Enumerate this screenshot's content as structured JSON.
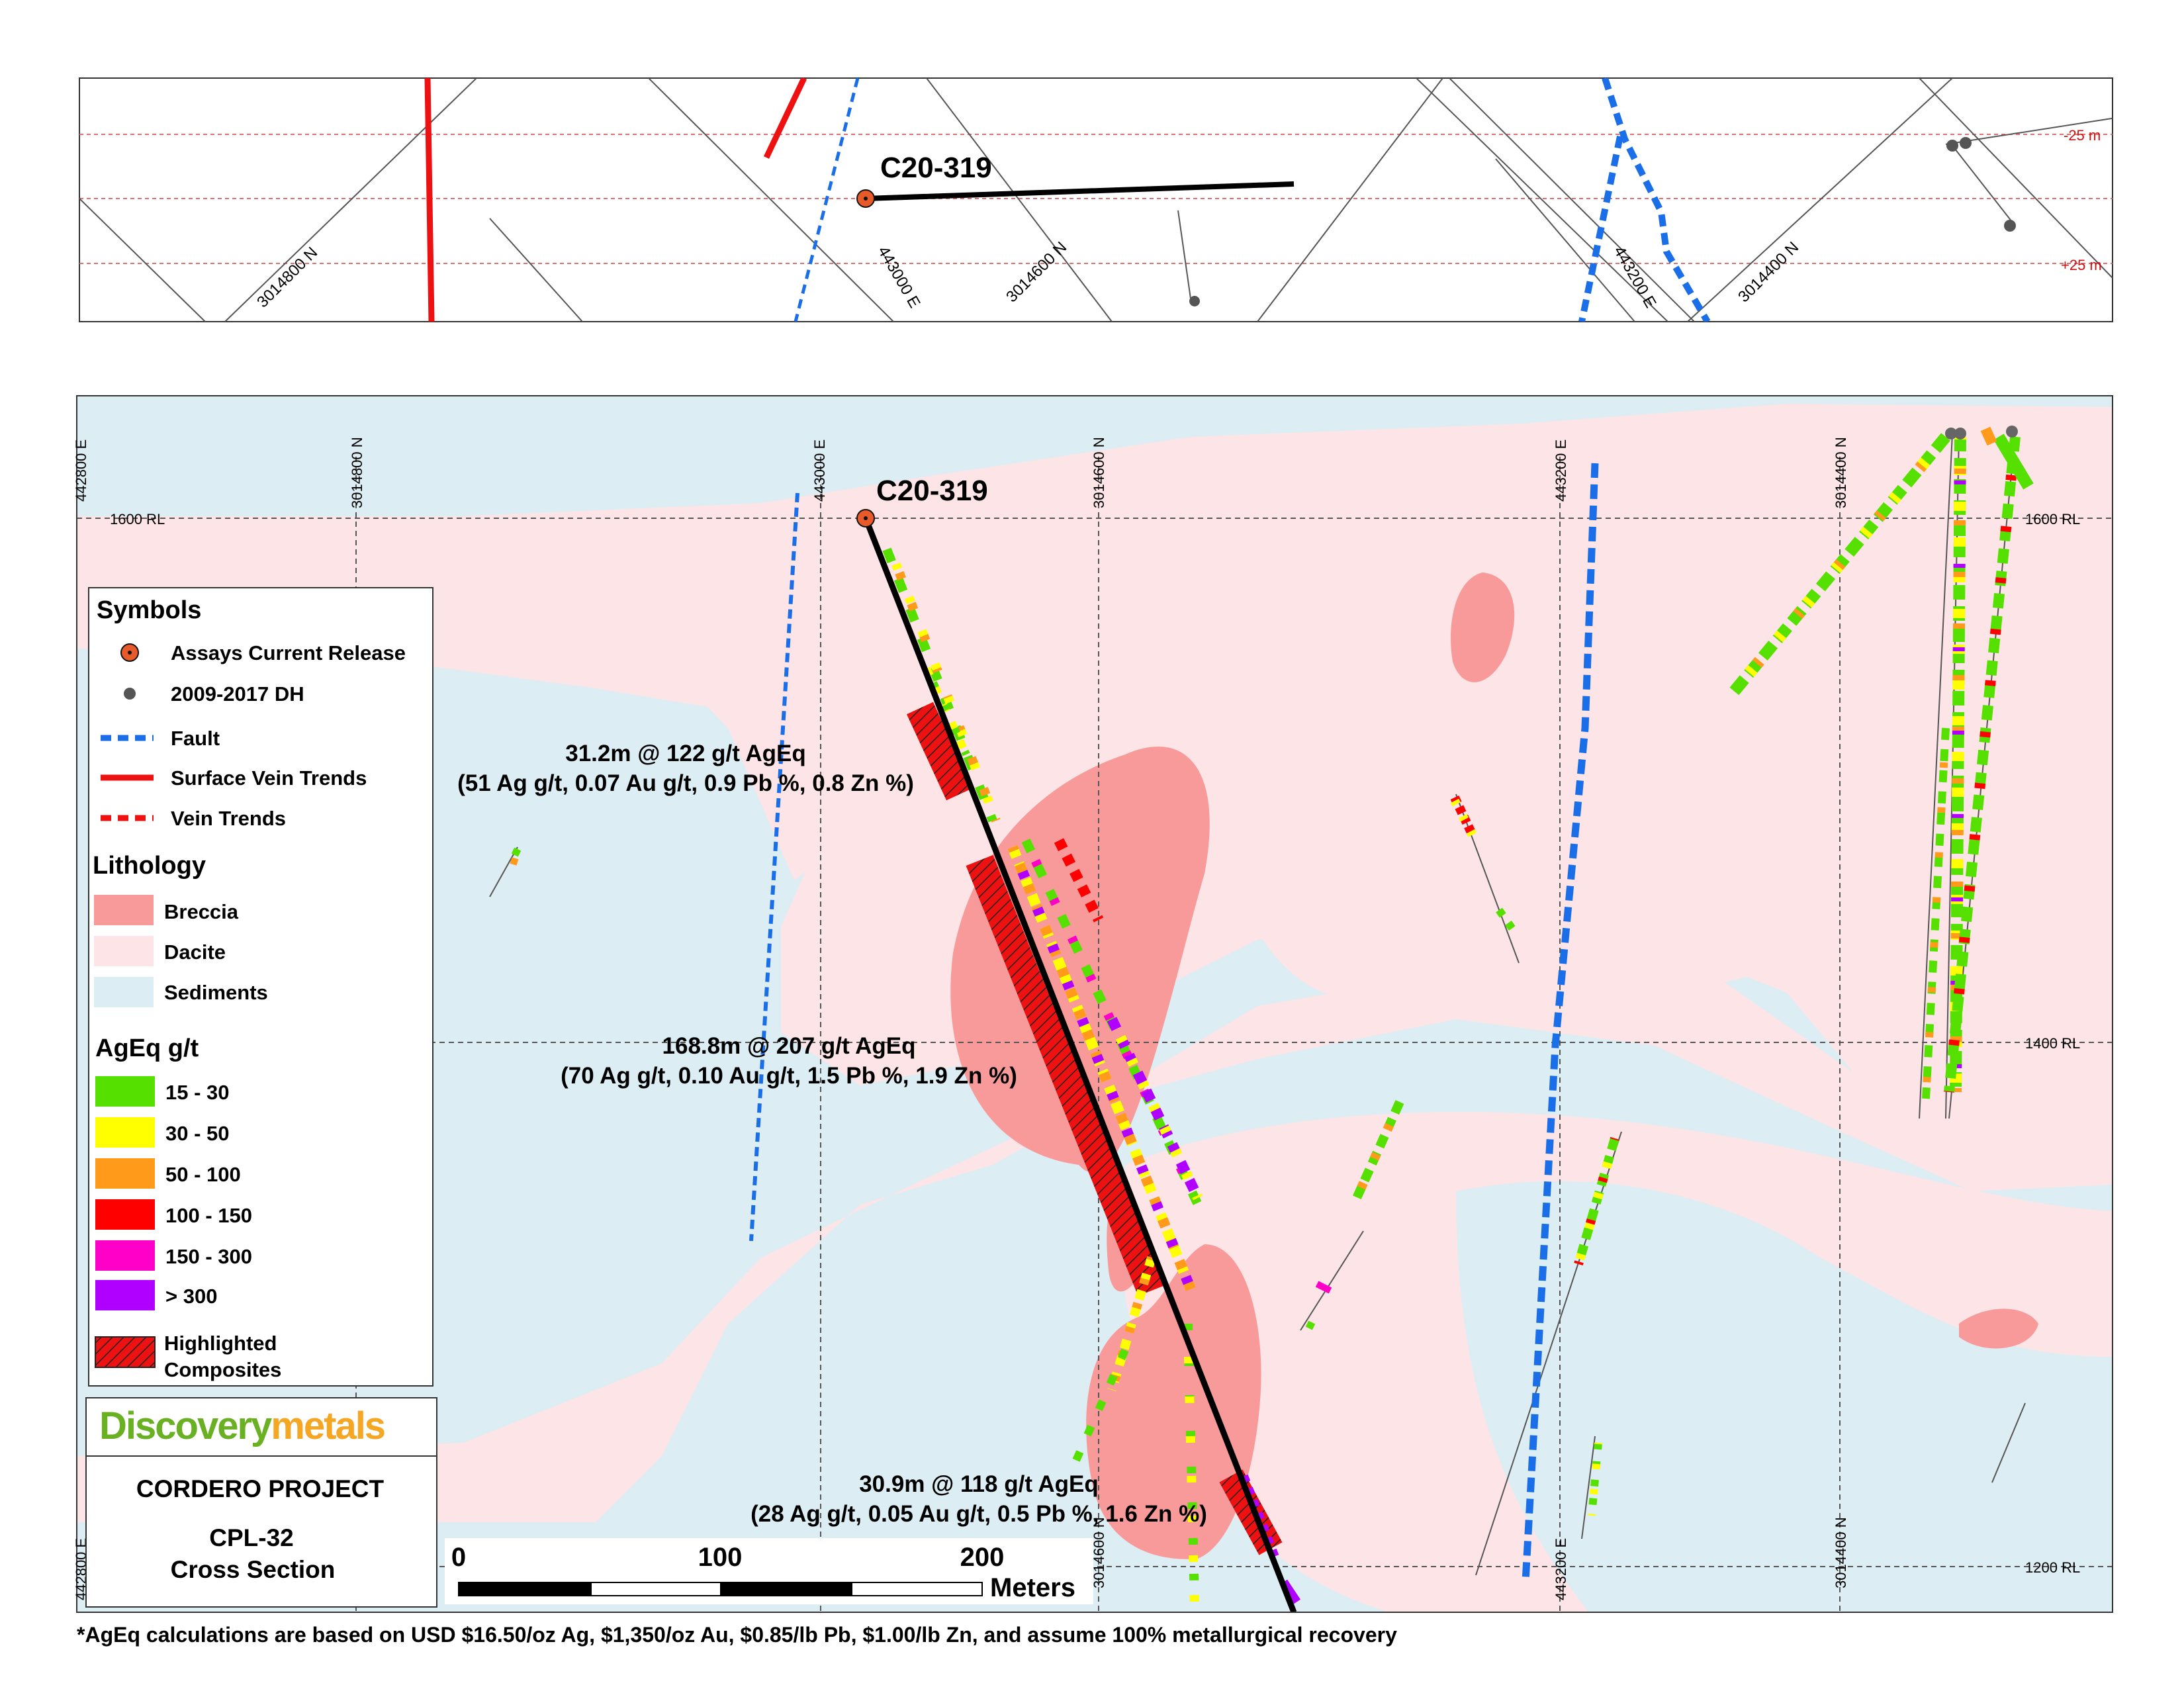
{
  "plan_view": {
    "hole_label": "C20-319",
    "grid_labels": [
      "3014800 N",
      "443000 E",
      "3014600 N",
      "443200 E",
      "3014400 N"
    ],
    "depth_labels": [
      "-25 m",
      "+25 m"
    ]
  },
  "section": {
    "hole_label": "C20-319",
    "rl_labels": [
      "1600 RL",
      "1400 RL",
      "1200 RL"
    ],
    "easting_labels": [
      "442800 E",
      "443000 E",
      "443200 E"
    ],
    "northing_labels": [
      "3014800 N",
      "3014600 N",
      "3014400 N"
    ],
    "bottom_labels": [
      "442800 E",
      "3014600 N",
      "443200 E",
      "3014400 N"
    ]
  },
  "intercepts": [
    {
      "line1": "31.2m @ 122 g/t AgEq",
      "line2": "(51 Ag g/t, 0.07 Au g/t, 0.9 Pb %, 0.8 Zn %)"
    },
    {
      "line1": "168.8m @ 207 g/t AgEq",
      "line2": "(70 Ag g/t, 0.10 Au g/t, 1.5 Pb %, 1.9 Zn %)"
    },
    {
      "line1": "30.9m @ 118 g/t AgEq",
      "line2": "(28 Ag g/t, 0.05 Au g/t, 0.5 Pb %, 1.6 Zn %)"
    }
  ],
  "legend": {
    "symbols_title": "Symbols",
    "symbols": [
      "Assays Current Release",
      "2009-2017 DH",
      "Fault",
      "Surface Vein Trends",
      "Vein Trends"
    ],
    "lithology_title": "Lithology",
    "lithology": [
      {
        "label": "Breccia",
        "color": "#f99a9a"
      },
      {
        "label": "Dacite",
        "color": "#fde4e6"
      },
      {
        "label": "Sediments",
        "color": "#dcedf3"
      }
    ],
    "grade_title": "AgEq g/t",
    "grades": [
      {
        "label": "15 - 30",
        "color": "#55e000"
      },
      {
        "label": "30 - 50",
        "color": "#ffff00"
      },
      {
        "label": "50 - 100",
        "color": "#ff9a1a"
      },
      {
        "label": "100 - 150",
        "color": "#ff0000"
      },
      {
        "label": "150 - 300",
        "color": "#ff00c8"
      },
      {
        "label": "> 300",
        "color": "#b000ff"
      }
    ],
    "highlight_line1": "Highlighted",
    "highlight_line2": "Composites"
  },
  "title_block": {
    "logo_part1": "Discovery",
    "logo_part2": "metals",
    "project": "CORDERO PROJECT",
    "section_id": "CPL-32",
    "section_type": "Cross Section"
  },
  "scale_bar": {
    "ticks": [
      "0",
      "100",
      "200"
    ],
    "unit": "Meters"
  },
  "footnote": "*AgEq calculations are based on USD $16.50/oz Ag, $1,350/oz Au, $0.85/lb Pb, $1.00/lb Zn, and assume 100% metallurgical recovery",
  "colors": {
    "breccia": "#f99a9a",
    "dacite": "#fde4e6",
    "sediments": "#dcedf3",
    "fault": "#1a6ee8",
    "vein": "#ee1111",
    "hole": "#000000",
    "logo_green": "#6ab023",
    "logo_orange": "#f5a623"
  }
}
